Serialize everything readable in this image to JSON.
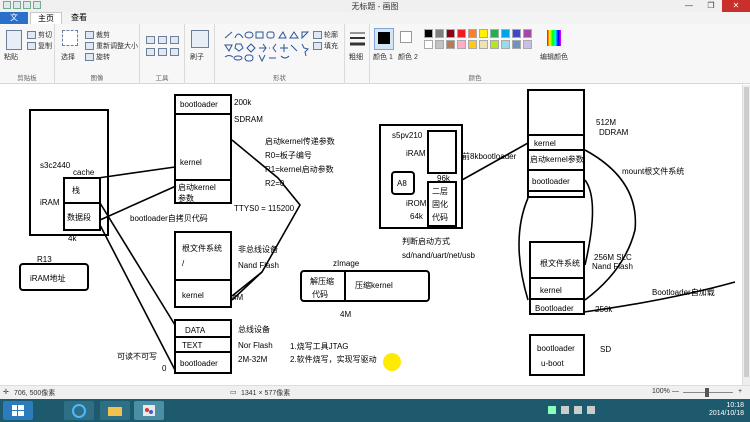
{
  "window": {
    "title": "无标题 - 画图"
  },
  "tabs": {
    "file": "文件",
    "home": "主页",
    "view": "查看"
  },
  "ribbon": {
    "clipboard": {
      "paste": "粘贴",
      "cut": "剪切",
      "copy": "复制",
      "caption": "剪贴板"
    },
    "image": {
      "select": "选择",
      "crop": "裁剪",
      "resize": "重新调整大小",
      "rotate": "旋转",
      "caption": "图像"
    },
    "tools": {
      "caption": "工具"
    },
    "brushes": {
      "label": "刷子"
    },
    "shapes": {
      "outline": "轮廓",
      "fill": "填充",
      "caption": "形状"
    },
    "size": {
      "label": "粗细"
    },
    "colors": {
      "color1": "颜色 1",
      "color2": "颜色 2",
      "edit": "编辑颜色",
      "caption": "颜色"
    },
    "palette": [
      "#000000",
      "#7f7f7f",
      "#880015",
      "#ed1c24",
      "#ff7f27",
      "#fff200",
      "#22b14c",
      "#00a2e8",
      "#3f48cc",
      "#a349a4",
      "#ffffff",
      "#c3c3c3",
      "#b97a57",
      "#ffaeC9",
      "#ffc90e",
      "#efe4b0",
      "#b5e61d",
      "#99d9ea",
      "#7092be",
      "#c8bfe7"
    ]
  },
  "canvas": {
    "left": {
      "chip": "s3c2440",
      "cache": "cache",
      "iram": "iRAM",
      "stack": "栈",
      "data_seg": "数据段",
      "size4k": "4k",
      "r13": "R13",
      "iram_addr": "iRAM地址"
    },
    "sdram": {
      "bootloader": "bootloader",
      "size": "200k",
      "name": "SDRAM",
      "kernel": "kernel",
      "start_kernel": "启动kernel",
      "params": "参数",
      "pass_params": "启动kernel传递参数",
      "r0": "R0=板子编号",
      "r1": "R1=kernel启动参数",
      "r2": "R2=0",
      "ttys": "TTYS0 = 115200",
      "copy_self": "bootloader自拷贝代码"
    },
    "nand": {
      "rootfs": "根文件系统",
      "slash": "/",
      "kernel": "kernel",
      "bus_label": "非总线设备",
      "flash_label": "Nand Flash",
      "size": "4M"
    },
    "nor": {
      "data": "DATA",
      "text": "TEXT",
      "bootloader": "bootloader",
      "bus_label": "总线设备",
      "flash_label": "Nor Flash",
      "size": "2M-32M",
      "readonly": "可读不可写",
      "zero": "0",
      "burn1": "1.烧写工具JTAG",
      "burn2": "2.软件烧写，实现写驱动"
    },
    "zimage": {
      "title": "zImage",
      "decompress": "解压缩",
      "code": "代码",
      "compressed": "压缩kernel",
      "size": "4M"
    },
    "s5pv210": {
      "chip": "s5pv210",
      "iram": "iRAM",
      "a8": "A8",
      "irom": "iROM",
      "irom_size": "64k",
      "iram_size": "96k",
      "fixed": "二层",
      "fixed2": "固化",
      "fixed3": "代码",
      "first8k": "前8kbootloader",
      "boot_mode": "判断启动方式",
      "boot_devs": "sd/nand/uart/net/usb"
    },
    "ddram": {
      "size": "512M",
      "name": "DDRAM",
      "kernel": "kernel",
      "start_kernel": "启动kernel参数",
      "bootloader": "bootloader",
      "mount": "mount根文件系统"
    },
    "slc": {
      "size": "256M SLC",
      "name": "Nand Flash",
      "rootfs": "根文件系统",
      "kernel": "kernel",
      "bootloader": "Bootloader",
      "bl_size": "256k",
      "autoload": "Bootloader自加载"
    },
    "sd": {
      "bootloader": "bootloader",
      "uboot": "u-boot",
      "label": "SD"
    }
  },
  "status": {
    "cursor": "706, 500像素",
    "canvas_size": "1341 × 577像素",
    "zoom": "100%"
  },
  "clock": {
    "time": "10:18",
    "date": "2014/10/18"
  }
}
